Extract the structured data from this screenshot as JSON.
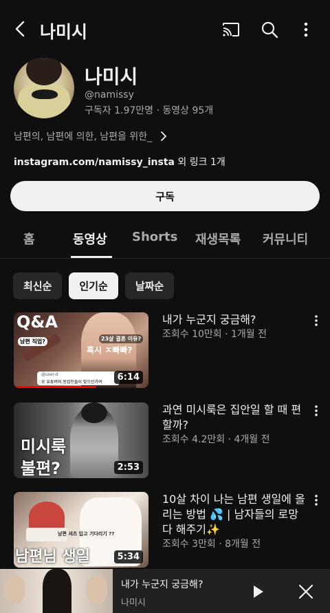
{
  "topbar": {
    "title": "나미시"
  },
  "channel": {
    "name": "나미시",
    "handle": "@namissy",
    "stats": "구독자 1.97만명 · 동영상 95개",
    "description": "남편의, 남편에 의한, 남편을 위한_",
    "link_main": "instagram.com/namissy_insta",
    "link_extra": " 외 링크 1개",
    "subscribe_label": "구독"
  },
  "tabs": [
    {
      "label": "홈",
      "active": false
    },
    {
      "label": "동영상",
      "active": true
    },
    {
      "label": "Shorts",
      "active": false
    },
    {
      "label": "재생목록",
      "active": false
    },
    {
      "label": "커뮤니티",
      "active": false
    }
  ],
  "chips": [
    {
      "label": "최신순",
      "active": false
    },
    {
      "label": "인기순",
      "active": true
    },
    {
      "label": "날짜순",
      "active": false
    }
  ],
  "videos": [
    {
      "title": "내가 누군지 궁금해?",
      "meta": "조회수 10만회 · 1개월 전",
      "duration": "6:14",
      "overlay": {
        "big": "Q&A",
        "tag1": "남편 직업?",
        "tag2": "23살 결혼 이유?",
        "tag3": "혹시 ㅈ빠빠?",
        "comment_user": "@user-d",
        "comment_text": "오 유튜버와 동업인들이 맞으신가여"
      }
    },
    {
      "title": "과연 미시룩은 집안일 할 때 편할까?",
      "meta": "조회수 4.2만회 · 4개월 전",
      "duration": "2:53",
      "overlay": {
        "big1": "미시룩",
        "big2": "불편?"
      }
    },
    {
      "title": "10살 차이 나는 남편 생일에 올리는 방법 💦 | 남자들의 로망 다 해주기✨",
      "meta": "조회수 3만회 · 8개월 전",
      "duration": "5:34",
      "overlay": {
        "small": "남편 셔츠 입고 기다리기 ??",
        "big": "남편님 생일"
      }
    }
  ],
  "miniplayer": {
    "title": "내가 누군지 궁금해?",
    "channel": "나미시"
  },
  "icons": {
    "back": "back-arrow-icon",
    "cast": "cast-icon",
    "search": "search-icon",
    "more": "more-vert-icon",
    "play": "play-icon",
    "close": "close-icon"
  }
}
